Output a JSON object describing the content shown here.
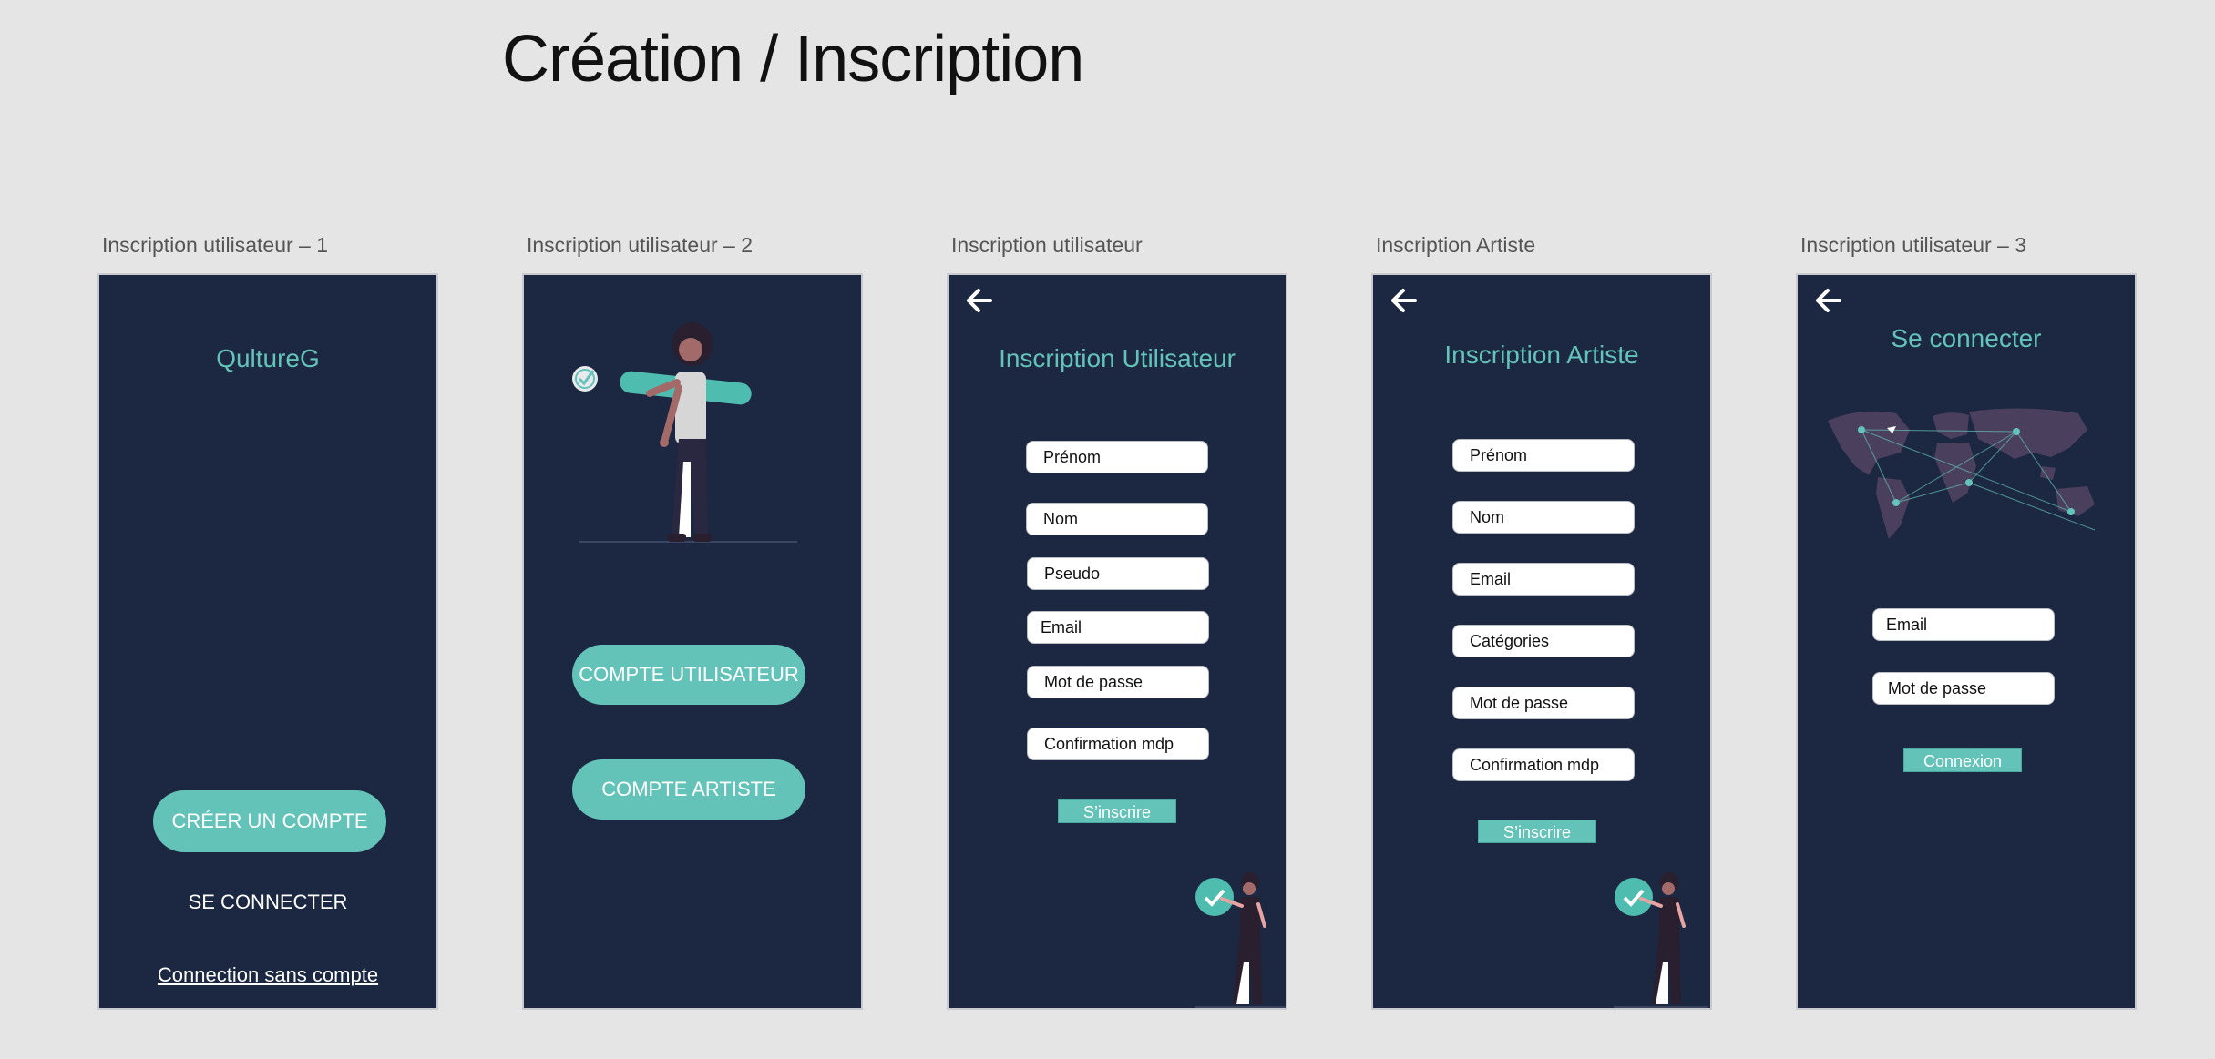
{
  "page_title": "Création / Inscription",
  "colors": {
    "background": "#e5e5e5",
    "frame": "#1c2841",
    "accent": "#63c3b9",
    "white": "#ffffff"
  },
  "frames": {
    "f1": {
      "label": "Inscription utilisateur – 1",
      "app_name": "QultureG",
      "create_button": "CRÉER UN COMPTE",
      "login_link": "SE CONNECTER",
      "guest_link": "Connection sans compte"
    },
    "f2": {
      "label": "Inscription utilisateur – 2",
      "user_button": "COMPTE UTILISATEUR",
      "artist_button": "COMPTE ARTISTE"
    },
    "f3": {
      "label": "Inscription utilisateur",
      "title": "Inscription Utilisateur",
      "fields": [
        "Prénom",
        "Nom",
        "Pseudo",
        "Email",
        "Mot de passe",
        "Confirmation mdp"
      ],
      "submit": "S’inscrire"
    },
    "f4": {
      "label": "Inscription Artiste",
      "title": "Inscription Artiste",
      "fields": [
        "Prénom",
        "Nom",
        "Email",
        "Catégories",
        "Mot de passe",
        "Confirmation mdp"
      ],
      "submit": "S’inscrire"
    },
    "f5": {
      "label": "Inscription utilisateur – 3",
      "title": "Se connecter",
      "fields": [
        "Email",
        "Mot de passe"
      ],
      "submit": "Connexion"
    }
  }
}
